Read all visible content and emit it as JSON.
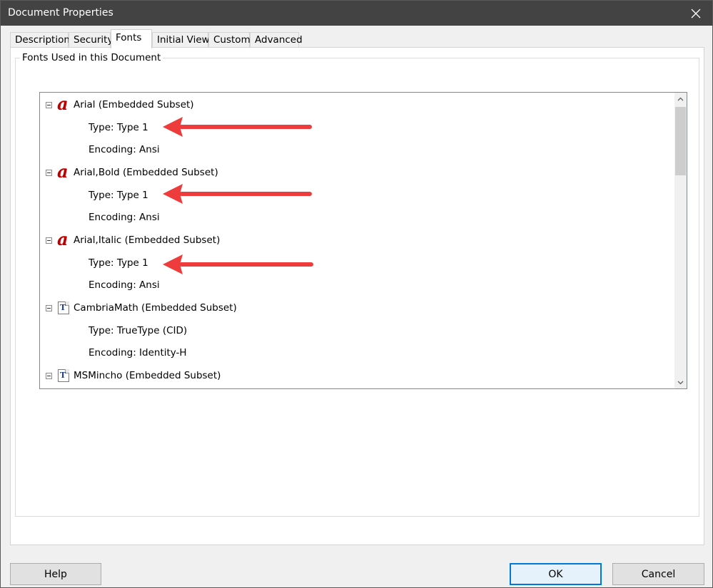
{
  "window": {
    "title": "Document Properties"
  },
  "tabs": [
    {
      "label": "Description"
    },
    {
      "label": "Security"
    },
    {
      "label": "Fonts"
    },
    {
      "label": "Initial View"
    },
    {
      "label": "Custom"
    },
    {
      "label": "Advanced"
    }
  ],
  "active_tab": "Fonts",
  "group": {
    "legend": "Fonts Used in this Document"
  },
  "fonts": [
    {
      "name": "Arial (Embedded Subset)",
      "icon": "type1-font-icon",
      "type": "Type: Type 1",
      "encoding": "Encoding: Ansi"
    },
    {
      "name": "Arial,Bold (Embedded Subset)",
      "icon": "type1-font-icon",
      "type": "Type: Type 1",
      "encoding": "Encoding: Ansi"
    },
    {
      "name": "Arial,Italic (Embedded Subset)",
      "icon": "type1-font-icon",
      "type": "Type: Type 1",
      "encoding": "Encoding: Ansi"
    },
    {
      "name": "CambriaMath (Embedded Subset)",
      "icon": "truetype-font-icon",
      "type": "Type: TrueType (CID)",
      "encoding": "Encoding: Identity-H"
    },
    {
      "name": "MSMincho (Embedded Subset)",
      "icon": "truetype-font-icon"
    }
  ],
  "buttons": {
    "help": "Help",
    "ok": "OK",
    "cancel": "Cancel"
  },
  "colors": {
    "titlebar": "#434343",
    "annotation_arrow": "#ee3b3b",
    "default_button_border": "#0078d7"
  }
}
